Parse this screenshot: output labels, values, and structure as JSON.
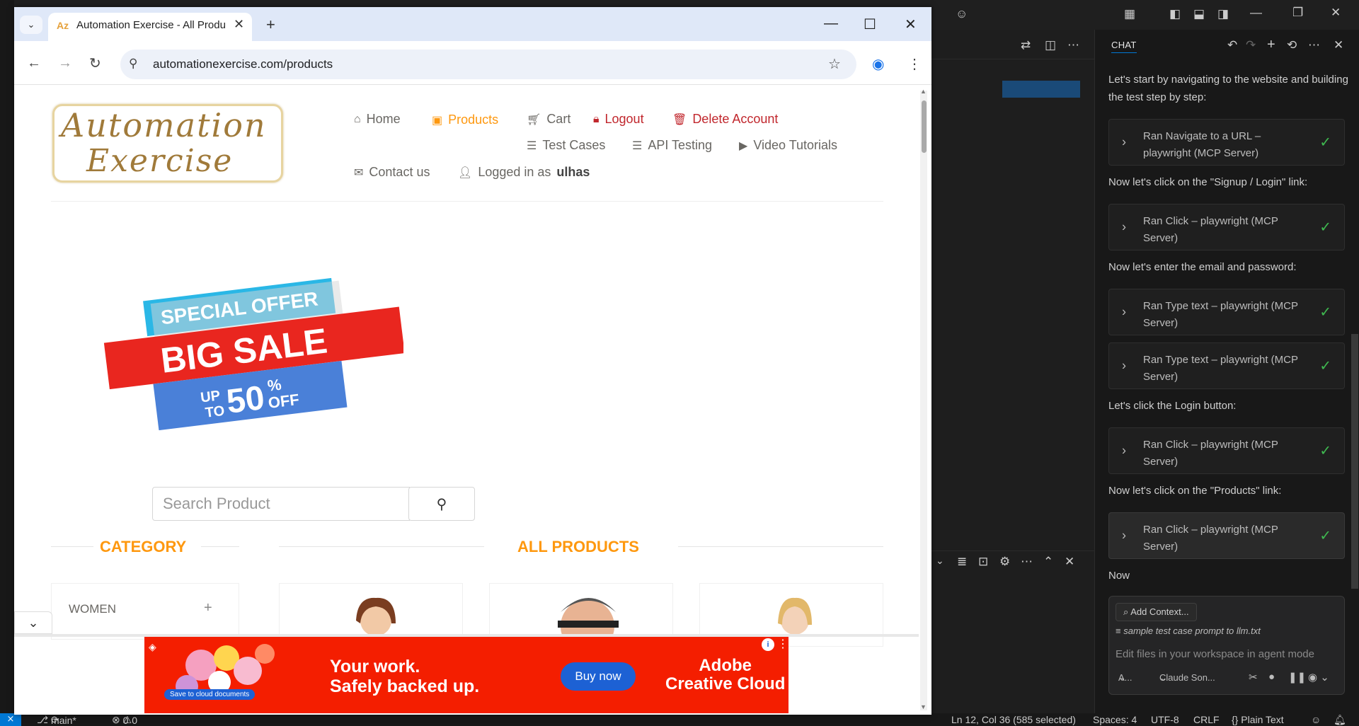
{
  "browser": {
    "tab_title": "Automation Exercise - All Produ",
    "url": "automationexercise.com/products",
    "new_tab": "+",
    "minimize": "—",
    "maximize": "☐",
    "close": "✕"
  },
  "site": {
    "logo_line1": "Automation",
    "logo_line2": "Exercise",
    "nav": {
      "home": "Home",
      "products": "Products",
      "cart": "Cart",
      "logout": "Logout",
      "delete_account": "Delete Account",
      "test_cases": "Test Cases",
      "api_testing": "API Testing",
      "video_tutorials": "Video Tutorials",
      "contact_us": "Contact us",
      "logged_in_as": "Logged in as",
      "username": "ulhas"
    },
    "banner": {
      "line1": "SPECIAL OFFER",
      "line2": "BIG SALE",
      "up": "UP",
      "to": "TO",
      "percent": "50",
      "percent_sign": "%",
      "off": "OFF"
    },
    "search_placeholder": "Search Product",
    "category_title": "CATEGORY",
    "all_products_title": "ALL PRODUCTS",
    "category_women": "WOMEN",
    "category_plus": "+"
  },
  "ad": {
    "headline_line1": "Your work.",
    "headline_line2": "Safely backed up.",
    "button": "Buy now",
    "brand_line1": "Adobe",
    "brand_line2": "Creative Cloud",
    "pill": "Save to cloud documents"
  },
  "chat": {
    "title": "CHAT",
    "intro": "Let's start by navigating to the website and building the test step by step:",
    "step_signup": "Now let's click on the \"Signup / Login\" link:",
    "step_email": "Now let's enter the email and password:",
    "step_login": "Let's click the Login button:",
    "step_products": "Now let's click on the \"Products\" link:",
    "step_now": "Now",
    "tools": [
      {
        "label": "Ran Navigate to a URL – playwright (MCP Server)"
      },
      {
        "label": "Ran Click – playwright (MCP Server)"
      },
      {
        "label": "Ran Type text – playwright (MCP Server)"
      },
      {
        "label": "Ran Type text – playwright (MCP Server)"
      },
      {
        "label": "Ran Click – playwright (MCP Server)"
      },
      {
        "label": "Ran Click – playwright (MCP Server)"
      }
    ],
    "add_context": "Add Context...",
    "attached_file": "sample test case prompt to llm.txt",
    "input_placeholder": "Edit files in your workspace in agent mode",
    "mode": "A...",
    "model": "Claude Son..."
  },
  "status": {
    "branch": "main*",
    "errors": "0",
    "warnings": "0",
    "position": "Ln 12, Col 36 (585 selected)",
    "spaces": "Spaces: 4",
    "encoding": "UTF-8",
    "eol": "CRLF",
    "language": "{} Plain Text"
  },
  "colors": {
    "accent_orange": "#fe980f",
    "danger_red": "#c1272d",
    "vscode_blue": "#0078d4",
    "check_green": "#3fb950"
  }
}
